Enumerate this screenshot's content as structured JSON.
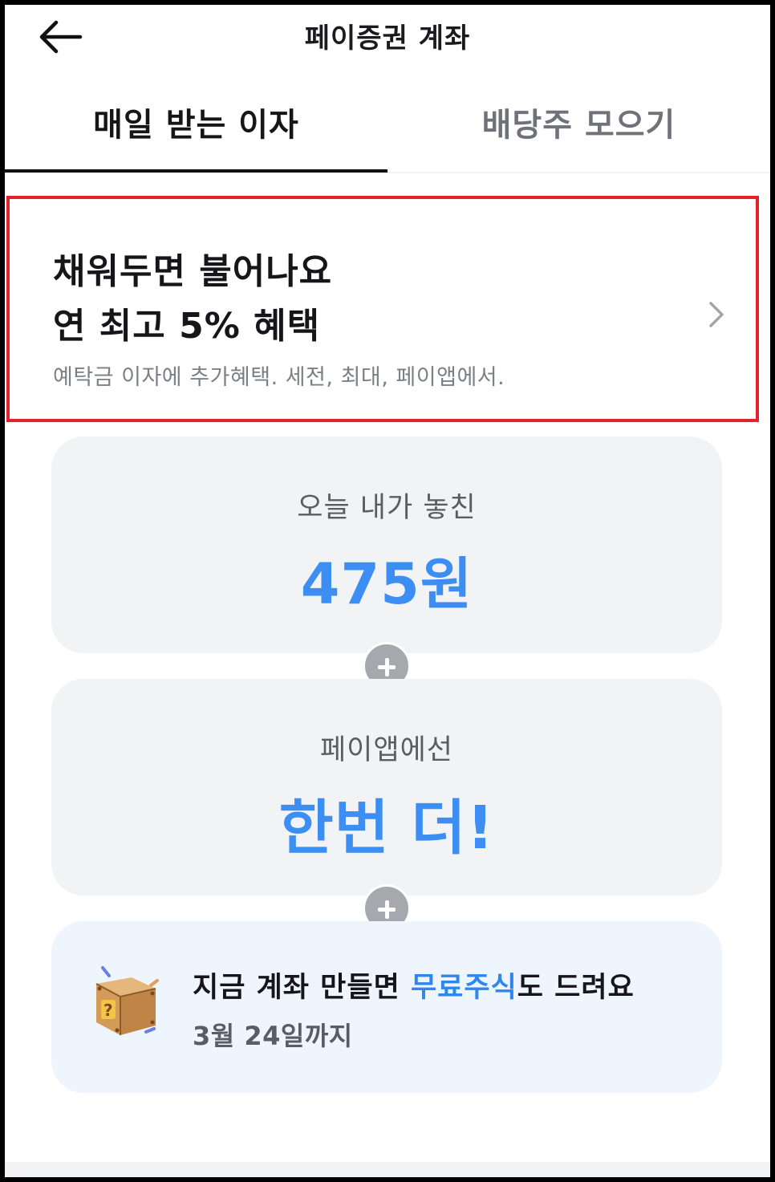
{
  "header": {
    "title": "페이증권 계좌",
    "back_icon": "arrow-left-icon"
  },
  "tabs": [
    {
      "label": "매일 받는 이자",
      "active": true
    },
    {
      "label": "배당주 모으기",
      "active": false
    }
  ],
  "promo": {
    "line1": "채워두면 불어나요",
    "line2": "연 최고 5% 혜택",
    "description": "예탁금 이자에 추가혜택. 세전, 최대, 페이앱에서.",
    "chevron_icon": "chevron-right-icon",
    "highlight_color": "#e4202d"
  },
  "missed_card": {
    "label": "오늘 내가 놓친",
    "value": "475원"
  },
  "plus_icon": "plus-circle-icon",
  "payapp_card": {
    "label": "페이앱에선",
    "value": "한번 더!"
  },
  "banner": {
    "text_before": "지금 계좌 만들면 ",
    "text_highlight": "무료주식",
    "text_after": "도 드려요",
    "sub": "3월 24일까지",
    "icon": "mystery-box-icon"
  },
  "colors": {
    "accent": "#3c8ef2",
    "card_bg": "#f2f3f5",
    "banner_bg": "#eef5fd"
  }
}
